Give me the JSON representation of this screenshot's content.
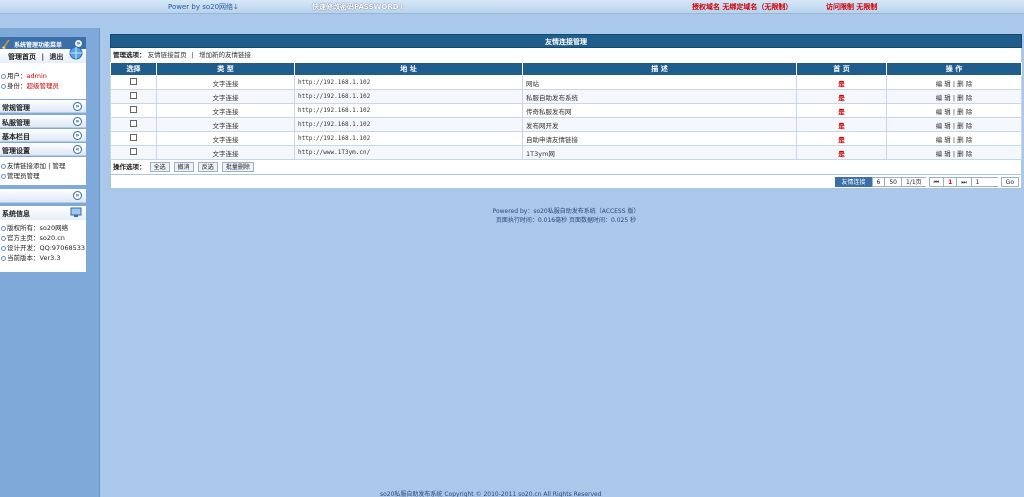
{
  "topbar": {
    "power": "Power by so20网络↓",
    "change_password": "快速修改密码PASSWORD↓",
    "domain": "授权域名 无绑定域名（无限制）",
    "visit": "访问限制 无限制"
  },
  "sidebar": {
    "header_title": "系统管理功能菜单",
    "nav_home": "管理首页",
    "nav_sep": "|",
    "nav_logout": "退出",
    "user_label": "用户：",
    "user_value": "admin",
    "role_label": "身份：",
    "role_value": "超级管理员",
    "sections": [
      {
        "label": "常规管理"
      },
      {
        "label": "私服管理"
      },
      {
        "label": "基本栏目"
      },
      {
        "label": "管理设置"
      }
    ],
    "sub_items": [
      "友情链接添加 | 管理",
      "管理员管理"
    ],
    "sysinfo_title": "系统信息",
    "sysinfo": [
      "版权所有：so20网络",
      "官方主页：so20.cn",
      "设计开发：QQ:97068533",
      "当前版本：Ver3.3"
    ]
  },
  "main": {
    "title": "友情连接管理",
    "options_label": "管理选项：",
    "options_link1": "友情链接首页",
    "options_sep": "|",
    "options_link2": "增加新的友情链接",
    "columns": [
      "选择",
      "类 型",
      "地 址",
      "描 述",
      "首 页",
      "操 作"
    ],
    "rows": [
      {
        "type": "文字连接",
        "url": "http://192.168.1.102",
        "desc": "网站",
        "home": "是",
        "edit": "编 辑",
        "sep": "|",
        "del": "删 除"
      },
      {
        "type": "文字连接",
        "url": "http://192.168.1.102",
        "desc": "私服自助发布系统",
        "home": "是",
        "edit": "编 辑",
        "sep": "|",
        "del": "删 除"
      },
      {
        "type": "文字连接",
        "url": "http://192.168.1.102",
        "desc": "传奇私服发布网",
        "home": "是",
        "edit": "编 辑",
        "sep": "|",
        "del": "删 除"
      },
      {
        "type": "文字连接",
        "url": "http://192.168.1.102",
        "desc": "发布网开发",
        "home": "是",
        "edit": "编 辑",
        "sep": "|",
        "del": "删 除"
      },
      {
        "type": "文字连接",
        "url": "http://192.168.1.102",
        "desc": "自助申请友情链接",
        "home": "是",
        "edit": "编 辑",
        "sep": "|",
        "del": "删 除"
      },
      {
        "type": "文字连接",
        "url": "http://www.1T3ym.cn/",
        "desc": "1T3ym网",
        "home": "是",
        "edit": "编 辑",
        "sep": "|",
        "del": "删 除"
      }
    ],
    "action_label": "操作选项：",
    "btn_select_all": "全选",
    "btn_cancel": "撤消",
    "btn_invert": "反选",
    "btn_batch_delete": "批量删除",
    "pager": {
      "title": "友情连接",
      "total": "6",
      "per_page": "50",
      "page_info": "1/1页",
      "first": "⏮",
      "current": "1",
      "last": "⏭",
      "input_value": "1",
      "go": "Go"
    }
  },
  "footer": {
    "powered": "Powered by：so20私服自助发布系统（ACCESS 版）",
    "timing": "页面执行时间：0.016毫秒  页面数据时间：0.025 秒",
    "bottom": "so20私服自助发布系统        Copyright © 2010-2011 so20.cn  All Rights Reserved"
  }
}
